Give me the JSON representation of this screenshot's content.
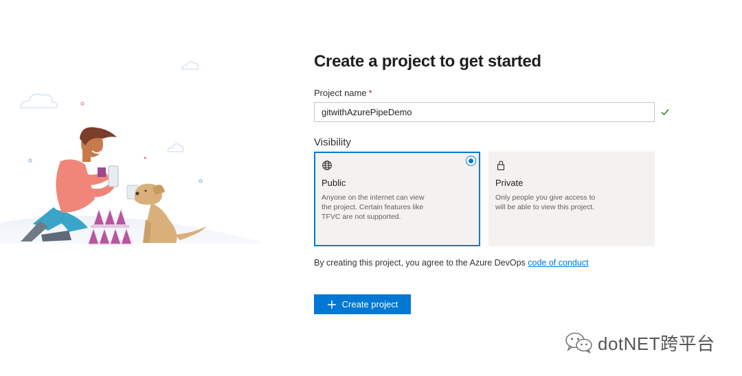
{
  "page": {
    "title": "Create a project to get started"
  },
  "project_name": {
    "label": "Project name",
    "required_mark": "*",
    "value": "gitwithAzurePipeDemo"
  },
  "visibility": {
    "label": "Visibility",
    "selected": "Public",
    "options": [
      {
        "title": "Public",
        "description": "Anyone on the internet can view the project. Certain features like TFVC are not supported.",
        "icon": "globe-icon"
      },
      {
        "title": "Private",
        "description": "Only people you give access to will be able to view this project.",
        "icon": "lock-icon"
      }
    ]
  },
  "agreement": {
    "text": "By creating this project, you agree to the Azure DevOps ",
    "link": "code of conduct"
  },
  "create_button": {
    "label": "Create project",
    "icon": "plus-icon"
  },
  "watermark": {
    "text": "dotNET跨平台",
    "icon": "wechat-icon"
  },
  "colors": {
    "accent": "#0078d4",
    "valid": "#107c10",
    "required": "#a4262c",
    "card_bg": "#f3f2f1"
  }
}
